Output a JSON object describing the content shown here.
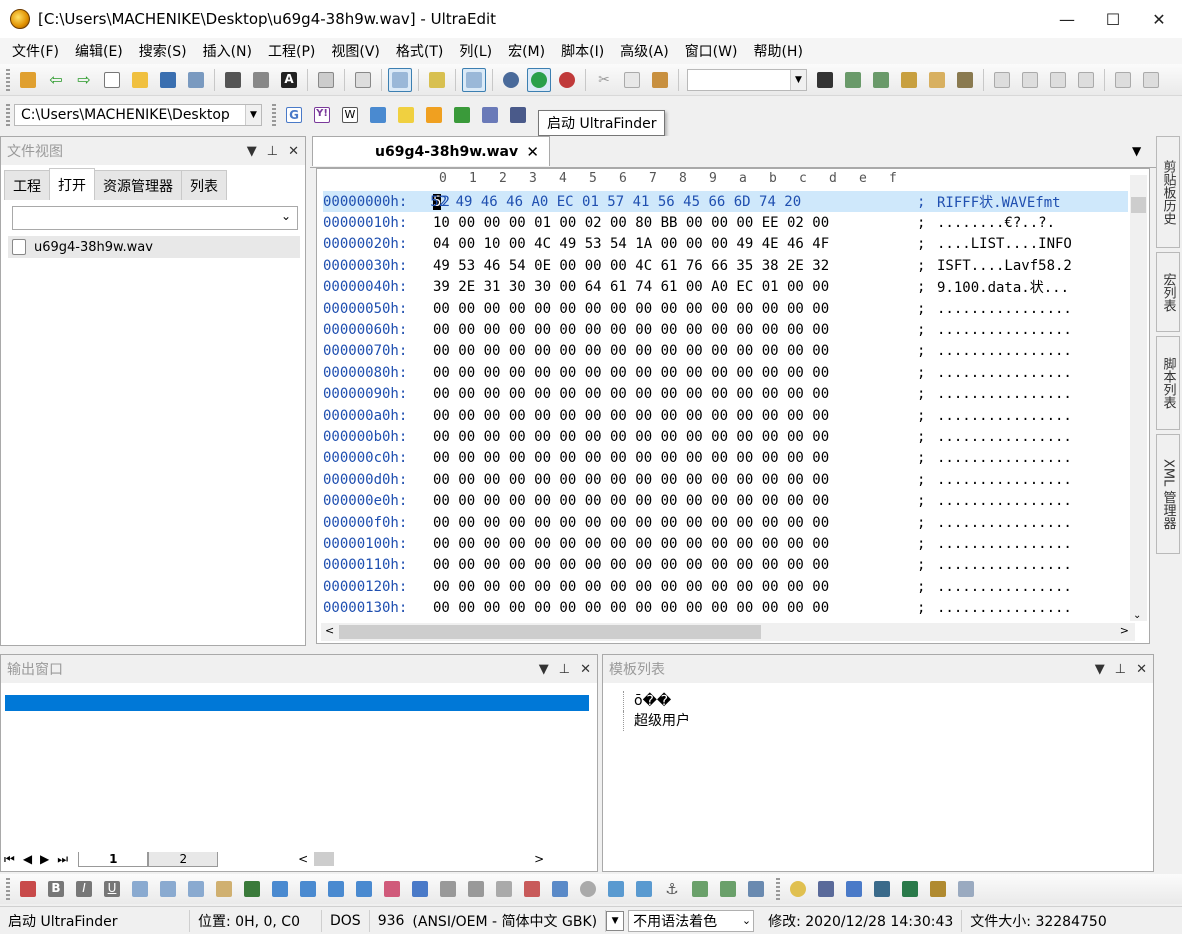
{
  "window": {
    "title": "[C:\\Users\\MACHENIKE\\Desktop\\u69g4-38h9w.wav] - UltraEdit",
    "minimize": "—",
    "maximize": "☐",
    "close": "✕"
  },
  "menu": [
    "文件(F)",
    "编辑(E)",
    "搜索(S)",
    "插入(N)",
    "工程(P)",
    "视图(V)",
    "格式(T)",
    "列(L)",
    "宏(M)",
    "脚本(I)",
    "高级(A)",
    "窗口(W)",
    "帮助(H)"
  ],
  "path_combo": "C:\\Users\\MACHENIKE\\Desktop",
  "tooltip": "启动 UltraFinder",
  "file_view": {
    "title": "文件视图",
    "tabs": [
      "工程",
      "打开",
      "资源管理器",
      "列表"
    ],
    "files": [
      "u69g4-38h9w.wav"
    ]
  },
  "document": {
    "tab_label": "u69g4-38h9w.wav",
    "ruler": [
      "0",
      "1",
      "2",
      "3",
      "4",
      "5",
      "6",
      "7",
      "8",
      "9",
      "a",
      "b",
      "c",
      "d",
      "e",
      "f"
    ],
    "rows": [
      {
        "offset": "00000000h:",
        "bytes": "52 49 46 46 A0 EC 01 57 41 56 45 66 6D 74 20",
        "ascii": "RIFFF状.WAVEfmt"
      },
      {
        "offset": "00000010h:",
        "bytes": "10 00 00 00 01 00 02 00 80 BB 00 00 00 EE 02 00",
        "ascii": "........€?..?."
      },
      {
        "offset": "00000020h:",
        "bytes": "04 00 10 00 4C 49 53 54 1A 00 00 00 49 4E 46 4F",
        "ascii": "....LIST....INFO"
      },
      {
        "offset": "00000030h:",
        "bytes": "49 53 46 54 0E 00 00 00 4C 61 76 66 35 38 2E 32",
        "ascii": "ISFT....Lavf58.2"
      },
      {
        "offset": "00000040h:",
        "bytes": "39 2E 31 30 30 00 64 61 74 61 00 A0 EC 01 00 00",
        "ascii": "9.100.data.状..."
      },
      {
        "offset": "00000050h:",
        "bytes": "00 00 00 00 00 00 00 00 00 00 00 00 00 00 00 00",
        "ascii": "................"
      },
      {
        "offset": "00000060h:",
        "bytes": "00 00 00 00 00 00 00 00 00 00 00 00 00 00 00 00",
        "ascii": "................"
      },
      {
        "offset": "00000070h:",
        "bytes": "00 00 00 00 00 00 00 00 00 00 00 00 00 00 00 00",
        "ascii": "................"
      },
      {
        "offset": "00000080h:",
        "bytes": "00 00 00 00 00 00 00 00 00 00 00 00 00 00 00 00",
        "ascii": "................"
      },
      {
        "offset": "00000090h:",
        "bytes": "00 00 00 00 00 00 00 00 00 00 00 00 00 00 00 00",
        "ascii": "................"
      },
      {
        "offset": "000000a0h:",
        "bytes": "00 00 00 00 00 00 00 00 00 00 00 00 00 00 00 00",
        "ascii": "................"
      },
      {
        "offset": "000000b0h:",
        "bytes": "00 00 00 00 00 00 00 00 00 00 00 00 00 00 00 00",
        "ascii": "................"
      },
      {
        "offset": "000000c0h:",
        "bytes": "00 00 00 00 00 00 00 00 00 00 00 00 00 00 00 00",
        "ascii": "................"
      },
      {
        "offset": "000000d0h:",
        "bytes": "00 00 00 00 00 00 00 00 00 00 00 00 00 00 00 00",
        "ascii": "................"
      },
      {
        "offset": "000000e0h:",
        "bytes": "00 00 00 00 00 00 00 00 00 00 00 00 00 00 00 00",
        "ascii": "................"
      },
      {
        "offset": "000000f0h:",
        "bytes": "00 00 00 00 00 00 00 00 00 00 00 00 00 00 00 00",
        "ascii": "................"
      },
      {
        "offset": "00000100h:",
        "bytes": "00 00 00 00 00 00 00 00 00 00 00 00 00 00 00 00",
        "ascii": "................"
      },
      {
        "offset": "00000110h:",
        "bytes": "00 00 00 00 00 00 00 00 00 00 00 00 00 00 00 00",
        "ascii": "................"
      },
      {
        "offset": "00000120h:",
        "bytes": "00 00 00 00 00 00 00 00 00 00 00 00 00 00 00 00",
        "ascii": "................"
      },
      {
        "offset": "00000130h:",
        "bytes": "00 00 00 00 00 00 00 00 00 00 00 00 00 00 00 00",
        "ascii": "................"
      }
    ]
  },
  "side_tabs": [
    "剪贴板历史",
    "宏列表",
    "脚本列表",
    "XML 管理器"
  ],
  "output_window": {
    "title": "输出窗口"
  },
  "template_list": {
    "title": "模板列表",
    "items": [
      "ō��",
      "超级用户"
    ]
  },
  "sheet_tabs": [
    "1",
    "2"
  ],
  "status": {
    "hint": "启动 UltraFinder",
    "position": "位置: 0H, 0, C0",
    "line_ending": "DOS",
    "codepage": "936",
    "encoding": "(ANSI/OEM - 简体中文 GBK)",
    "highlighting": "不用语法着色",
    "modified": "修改: 2020/12/28 14:30:43",
    "file_size": "文件大小: 32284750"
  },
  "colors": {
    "accent": "#0078d7",
    "offset_blue": "#1f4fb0",
    "selected_row": "#cfe8fb"
  }
}
